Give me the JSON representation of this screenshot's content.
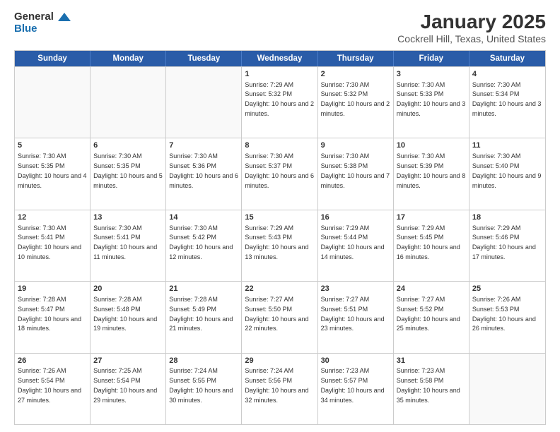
{
  "header": {
    "logo": {
      "text1": "General",
      "text2": "Blue"
    },
    "title": "January 2025",
    "subtitle": "Cockrell Hill, Texas, United States"
  },
  "days_of_week": [
    "Sunday",
    "Monday",
    "Tuesday",
    "Wednesday",
    "Thursday",
    "Friday",
    "Saturday"
  ],
  "weeks": [
    [
      {
        "day": "",
        "sunrise": "",
        "sunset": "",
        "daylight": "",
        "empty": true
      },
      {
        "day": "",
        "sunrise": "",
        "sunset": "",
        "daylight": "",
        "empty": true
      },
      {
        "day": "",
        "sunrise": "",
        "sunset": "",
        "daylight": "",
        "empty": true
      },
      {
        "day": "1",
        "sunrise": "Sunrise: 7:29 AM",
        "sunset": "Sunset: 5:32 PM",
        "daylight": "Daylight: 10 hours and 2 minutes.",
        "empty": false
      },
      {
        "day": "2",
        "sunrise": "Sunrise: 7:30 AM",
        "sunset": "Sunset: 5:32 PM",
        "daylight": "Daylight: 10 hours and 2 minutes.",
        "empty": false
      },
      {
        "day": "3",
        "sunrise": "Sunrise: 7:30 AM",
        "sunset": "Sunset: 5:33 PM",
        "daylight": "Daylight: 10 hours and 3 minutes.",
        "empty": false
      },
      {
        "day": "4",
        "sunrise": "Sunrise: 7:30 AM",
        "sunset": "Sunset: 5:34 PM",
        "daylight": "Daylight: 10 hours and 3 minutes.",
        "empty": false
      }
    ],
    [
      {
        "day": "5",
        "sunrise": "Sunrise: 7:30 AM",
        "sunset": "Sunset: 5:35 PM",
        "daylight": "Daylight: 10 hours and 4 minutes.",
        "empty": false
      },
      {
        "day": "6",
        "sunrise": "Sunrise: 7:30 AM",
        "sunset": "Sunset: 5:35 PM",
        "daylight": "Daylight: 10 hours and 5 minutes.",
        "empty": false
      },
      {
        "day": "7",
        "sunrise": "Sunrise: 7:30 AM",
        "sunset": "Sunset: 5:36 PM",
        "daylight": "Daylight: 10 hours and 6 minutes.",
        "empty": false
      },
      {
        "day": "8",
        "sunrise": "Sunrise: 7:30 AM",
        "sunset": "Sunset: 5:37 PM",
        "daylight": "Daylight: 10 hours and 6 minutes.",
        "empty": false
      },
      {
        "day": "9",
        "sunrise": "Sunrise: 7:30 AM",
        "sunset": "Sunset: 5:38 PM",
        "daylight": "Daylight: 10 hours and 7 minutes.",
        "empty": false
      },
      {
        "day": "10",
        "sunrise": "Sunrise: 7:30 AM",
        "sunset": "Sunset: 5:39 PM",
        "daylight": "Daylight: 10 hours and 8 minutes.",
        "empty": false
      },
      {
        "day": "11",
        "sunrise": "Sunrise: 7:30 AM",
        "sunset": "Sunset: 5:40 PM",
        "daylight": "Daylight: 10 hours and 9 minutes.",
        "empty": false
      }
    ],
    [
      {
        "day": "12",
        "sunrise": "Sunrise: 7:30 AM",
        "sunset": "Sunset: 5:41 PM",
        "daylight": "Daylight: 10 hours and 10 minutes.",
        "empty": false
      },
      {
        "day": "13",
        "sunrise": "Sunrise: 7:30 AM",
        "sunset": "Sunset: 5:41 PM",
        "daylight": "Daylight: 10 hours and 11 minutes.",
        "empty": false
      },
      {
        "day": "14",
        "sunrise": "Sunrise: 7:30 AM",
        "sunset": "Sunset: 5:42 PM",
        "daylight": "Daylight: 10 hours and 12 minutes.",
        "empty": false
      },
      {
        "day": "15",
        "sunrise": "Sunrise: 7:29 AM",
        "sunset": "Sunset: 5:43 PM",
        "daylight": "Daylight: 10 hours and 13 minutes.",
        "empty": false
      },
      {
        "day": "16",
        "sunrise": "Sunrise: 7:29 AM",
        "sunset": "Sunset: 5:44 PM",
        "daylight": "Daylight: 10 hours and 14 minutes.",
        "empty": false
      },
      {
        "day": "17",
        "sunrise": "Sunrise: 7:29 AM",
        "sunset": "Sunset: 5:45 PM",
        "daylight": "Daylight: 10 hours and 16 minutes.",
        "empty": false
      },
      {
        "day": "18",
        "sunrise": "Sunrise: 7:29 AM",
        "sunset": "Sunset: 5:46 PM",
        "daylight": "Daylight: 10 hours and 17 minutes.",
        "empty": false
      }
    ],
    [
      {
        "day": "19",
        "sunrise": "Sunrise: 7:28 AM",
        "sunset": "Sunset: 5:47 PM",
        "daylight": "Daylight: 10 hours and 18 minutes.",
        "empty": false
      },
      {
        "day": "20",
        "sunrise": "Sunrise: 7:28 AM",
        "sunset": "Sunset: 5:48 PM",
        "daylight": "Daylight: 10 hours and 19 minutes.",
        "empty": false
      },
      {
        "day": "21",
        "sunrise": "Sunrise: 7:28 AM",
        "sunset": "Sunset: 5:49 PM",
        "daylight": "Daylight: 10 hours and 21 minutes.",
        "empty": false
      },
      {
        "day": "22",
        "sunrise": "Sunrise: 7:27 AM",
        "sunset": "Sunset: 5:50 PM",
        "daylight": "Daylight: 10 hours and 22 minutes.",
        "empty": false
      },
      {
        "day": "23",
        "sunrise": "Sunrise: 7:27 AM",
        "sunset": "Sunset: 5:51 PM",
        "daylight": "Daylight: 10 hours and 23 minutes.",
        "empty": false
      },
      {
        "day": "24",
        "sunrise": "Sunrise: 7:27 AM",
        "sunset": "Sunset: 5:52 PM",
        "daylight": "Daylight: 10 hours and 25 minutes.",
        "empty": false
      },
      {
        "day": "25",
        "sunrise": "Sunrise: 7:26 AM",
        "sunset": "Sunset: 5:53 PM",
        "daylight": "Daylight: 10 hours and 26 minutes.",
        "empty": false
      }
    ],
    [
      {
        "day": "26",
        "sunrise": "Sunrise: 7:26 AM",
        "sunset": "Sunset: 5:54 PM",
        "daylight": "Daylight: 10 hours and 27 minutes.",
        "empty": false
      },
      {
        "day": "27",
        "sunrise": "Sunrise: 7:25 AM",
        "sunset": "Sunset: 5:54 PM",
        "daylight": "Daylight: 10 hours and 29 minutes.",
        "empty": false
      },
      {
        "day": "28",
        "sunrise": "Sunrise: 7:24 AM",
        "sunset": "Sunset: 5:55 PM",
        "daylight": "Daylight: 10 hours and 30 minutes.",
        "empty": false
      },
      {
        "day": "29",
        "sunrise": "Sunrise: 7:24 AM",
        "sunset": "Sunset: 5:56 PM",
        "daylight": "Daylight: 10 hours and 32 minutes.",
        "empty": false
      },
      {
        "day": "30",
        "sunrise": "Sunrise: 7:23 AM",
        "sunset": "Sunset: 5:57 PM",
        "daylight": "Daylight: 10 hours and 34 minutes.",
        "empty": false
      },
      {
        "day": "31",
        "sunrise": "Sunrise: 7:23 AM",
        "sunset": "Sunset: 5:58 PM",
        "daylight": "Daylight: 10 hours and 35 minutes.",
        "empty": false
      },
      {
        "day": "",
        "sunrise": "",
        "sunset": "",
        "daylight": "",
        "empty": true
      }
    ]
  ]
}
